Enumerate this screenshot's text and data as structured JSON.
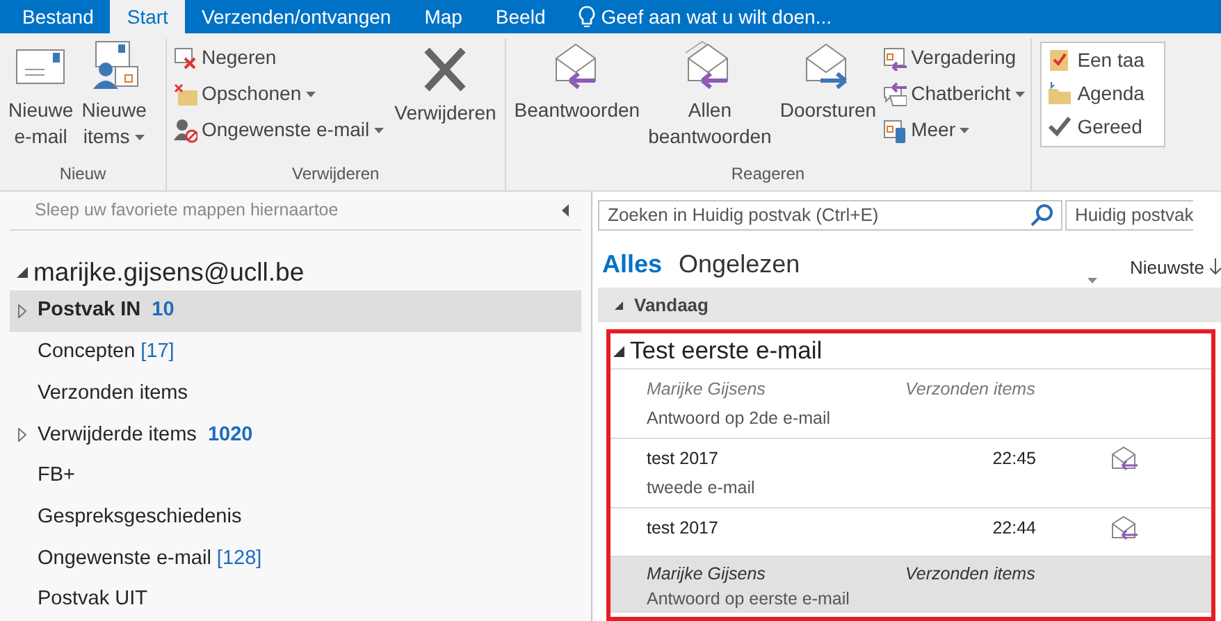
{
  "ribbon_tabs": [
    {
      "label": "Bestand",
      "selected": false
    },
    {
      "label": "Start",
      "selected": true
    },
    {
      "label": "Verzenden/ontvangen",
      "selected": false
    },
    {
      "label": "Map",
      "selected": false
    },
    {
      "label": "Beeld",
      "selected": false
    }
  ],
  "tell_me": {
    "placeholder": "Geef aan wat u wilt doen..."
  },
  "ribbon_groups": [
    {
      "label": "Nieuw",
      "items": [
        {
          "kind": "large",
          "label": "Nieuwe e-mail",
          "dropdown": false
        },
        {
          "kind": "large",
          "label": "Nieuwe items",
          "dropdown": true
        }
      ]
    },
    {
      "label": "Verwijderen",
      "items": [
        {
          "kind": "small",
          "label": "Negeren",
          "dropdown": false
        },
        {
          "kind": "small",
          "label": "Opschonen",
          "dropdown": true
        },
        {
          "kind": "small",
          "label": "Ongewenste e-mail",
          "dropdown": true
        },
        {
          "kind": "large",
          "label": "Verwijderen",
          "dropdown": false
        }
      ]
    },
    {
      "label": "Reageren",
      "items": [
        {
          "kind": "large",
          "label": "Beantwoorden",
          "dropdown": false
        },
        {
          "kind": "large",
          "label": "Allen beantwoorden",
          "dropdown": false
        },
        {
          "kind": "large",
          "label": "Doorsturen",
          "dropdown": false
        },
        {
          "kind": "small",
          "label": "Vergadering",
          "dropdown": false
        },
        {
          "kind": "small",
          "label": "Chatbericht",
          "dropdown": true
        },
        {
          "kind": "small",
          "label": "Meer",
          "dropdown": true
        }
      ]
    }
  ],
  "quick_steps": [
    "Een taa",
    "Agenda",
    "Gereed"
  ],
  "favorites_hint": "Sleep uw favoriete mappen hiernaartoe",
  "account": {
    "name": "marijke.gijsens@ucll.be",
    "expanded": true
  },
  "folders": [
    {
      "name": "Postvak IN",
      "count": "10",
      "unread": true,
      "has_children": true,
      "selected": true
    },
    {
      "name": "Concepten",
      "count": "[17]",
      "unread": false,
      "has_children": false,
      "selected": false
    },
    {
      "name": "Verzonden items",
      "has_children": false,
      "selected": false
    },
    {
      "name": "Verwijderde items",
      "count": "1020",
      "unread": true,
      "has_children": true,
      "selected": false
    },
    {
      "name": "FB+",
      "has_children": false,
      "selected": false
    },
    {
      "name": "Gespreksgeschiedenis",
      "has_children": false,
      "selected": false
    },
    {
      "name": "Ongewenste e-mail",
      "count": "[128]",
      "unread": false,
      "has_children": false,
      "selected": false
    },
    {
      "name": "Postvak UIT",
      "has_children": false,
      "selected": false
    }
  ],
  "search": {
    "placeholder": "Zoeken in Huidig postvak (Ctrl+E)",
    "scope": "Huidig postvak"
  },
  "filters": [
    {
      "label": "Alles",
      "selected": true
    },
    {
      "label": "Ongelezen",
      "selected": false
    }
  ],
  "sort": "Nieuwste",
  "group_header": "Vandaag",
  "conversation": {
    "subject": "Test eerste e-mail",
    "expanded": true,
    "messages": [
      {
        "kind": "sent",
        "sender": "Marijke Gijsens",
        "folder": "Verzonden items",
        "preview": "Antwoord op 2de e-mail",
        "selected": false
      },
      {
        "kind": "received",
        "sender": "test 2017",
        "time": "22:45",
        "preview": "tweede e-mail",
        "selected": false
      },
      {
        "kind": "received",
        "sender": "test 2017",
        "time": "22:44",
        "selected": false
      },
      {
        "kind": "sent",
        "sender": "Marijke Gijsens",
        "folder": "Verzonden items",
        "preview": "Antwoord op eerste e-mail",
        "selected": true
      }
    ]
  }
}
